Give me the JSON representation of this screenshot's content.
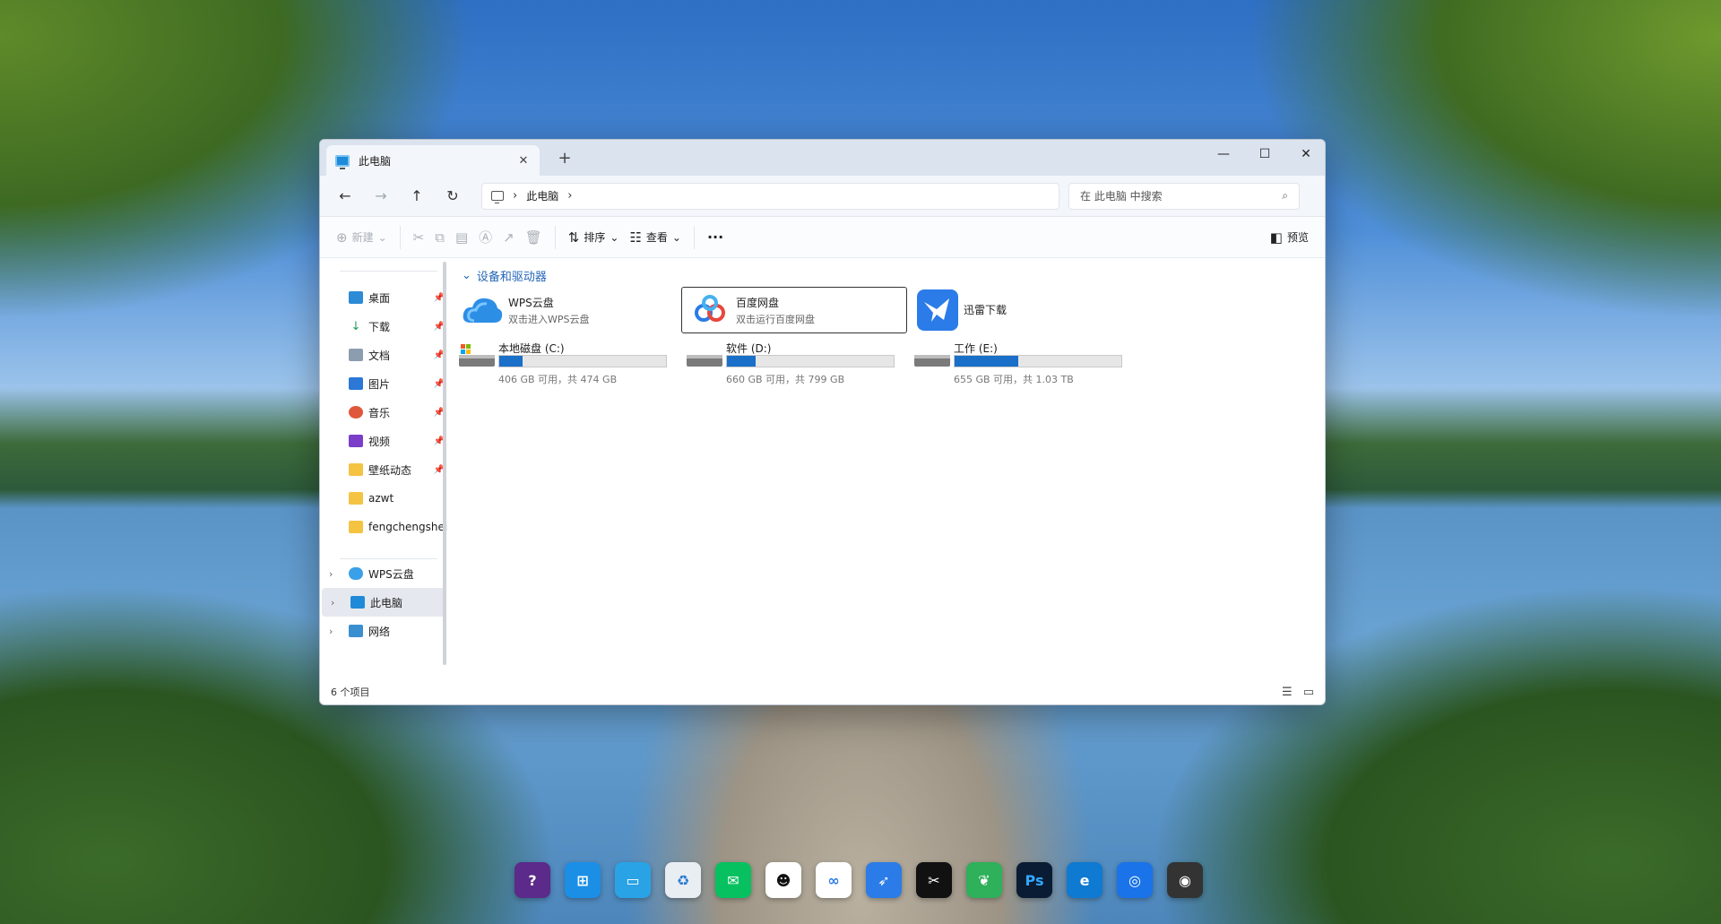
{
  "window": {
    "tab_title": "此电脑",
    "close_tab": "✕",
    "new_tab": "+",
    "minimize": "—",
    "maximize": "☐",
    "close": "✕"
  },
  "nav": {
    "back": "←",
    "forward": "→",
    "up": "↑",
    "refresh": "↻",
    "breadcrumb_chevron": "›",
    "breadcrumb_current": "此电脑",
    "search_placeholder": "在 此电脑 中搜索",
    "search_icon": "⌕"
  },
  "toolbar": {
    "new_label": "新建",
    "sort_label": "排序",
    "view_label": "查看",
    "more": "···",
    "preview_label": "预览"
  },
  "sidebar": {
    "items": [
      {
        "label": "桌面",
        "icon": "desktop-icon"
      },
      {
        "label": "下载",
        "icon": "download-icon"
      },
      {
        "label": "文档",
        "icon": "document-icon"
      },
      {
        "label": "图片",
        "icon": "picture-icon"
      },
      {
        "label": "音乐",
        "icon": "music-icon"
      },
      {
        "label": "视频",
        "icon": "video-icon"
      },
      {
        "label": "壁纸动态",
        "icon": "folder-icon"
      },
      {
        "label": "azwt",
        "icon": "folder-icon"
      },
      {
        "label": "fengchengshej",
        "icon": "folder-icon"
      }
    ],
    "sections": [
      {
        "label": "WPS云盘",
        "icon": "cloud-icon"
      },
      {
        "label": "此电脑",
        "icon": "computer-icon"
      },
      {
        "label": "网络",
        "icon": "network-icon"
      }
    ]
  },
  "content": {
    "group_header": "设备和驱动器",
    "tiles": [
      {
        "name": "WPS云盘",
        "sub": "双击进入WPS云盘"
      },
      {
        "name": "百度网盘",
        "sub": "双击运行百度网盘"
      },
      {
        "name": "迅雷下载",
        "sub": ""
      }
    ],
    "drives": [
      {
        "name": "本地磁盘 (C:)",
        "size": "406 GB 可用，共 474 GB",
        "used_fraction": 0.14
      },
      {
        "name": "软件 (D:)",
        "size": "660 GB 可用，共 799 GB",
        "used_fraction": 0.17
      },
      {
        "name": "工作 (E:)",
        "size": "655 GB 可用，共 1.03 TB",
        "used_fraction": 0.38
      }
    ]
  },
  "status": {
    "item_count": "6 个项目"
  },
  "colors": {
    "accent": "#1a6fc9",
    "group_header": "#2466b8"
  },
  "dock": [
    "app-icon",
    "windows-icon",
    "desktop-icon",
    "recycle-bin-icon",
    "wechat-icon",
    "qq-icon",
    "baidu-netdisk-icon",
    "xunlei-icon",
    "capcut-icon",
    "leaf-app-icon",
    "photoshop-icon",
    "edge-icon",
    "browser-icon",
    "camera-icon"
  ]
}
